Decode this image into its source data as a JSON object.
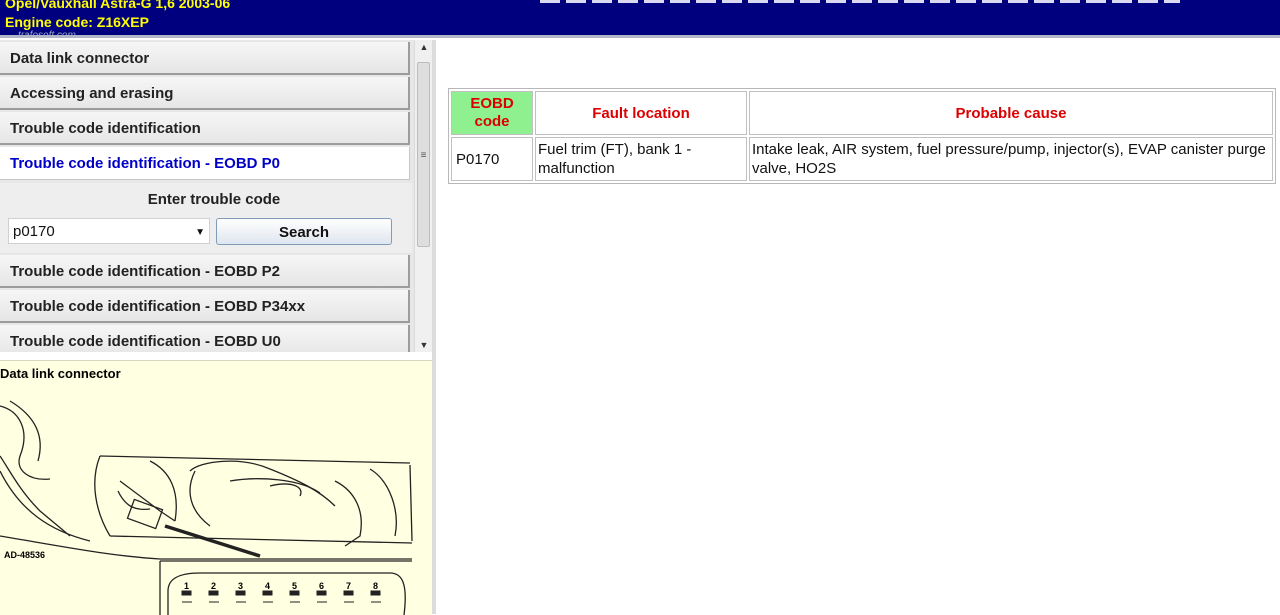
{
  "header": {
    "vehicle_line": "Opel/Vauxhall   Astra-G  1,6  2003-06",
    "engine_line": "Engine code: Z16XEP",
    "watermark": "trafosoft.com"
  },
  "nav": {
    "items": [
      {
        "label": "Data link connector"
      },
      {
        "label": "Accessing and erasing"
      },
      {
        "label": "Trouble code identification"
      },
      {
        "label": "Trouble code identification - EOBD P0"
      },
      {
        "label": "Trouble code identification - EOBD P2"
      },
      {
        "label": "Trouble code identification - EOBD P34xx"
      },
      {
        "label": "Trouble code identification - EOBD U0"
      }
    ],
    "active_index": 3
  },
  "search": {
    "label": "Enter trouble code",
    "value": "p0170",
    "button_label": "Search"
  },
  "diagram": {
    "title": "Data link connector",
    "ref_code": "AD-48536",
    "pins": [
      "1",
      "2",
      "3",
      "4",
      "5",
      "6",
      "7",
      "8"
    ]
  },
  "table": {
    "headers": {
      "code": "EOBD code",
      "fault": "Fault location",
      "cause": "Probable cause"
    },
    "rows": [
      {
        "code": "P0170",
        "fault": "Fuel trim (FT), bank 1 - malfunction",
        "cause": "Intake leak, AIR system, fuel pressure/pump, injector(s), EVAP canister purge valve, HO2S"
      }
    ]
  },
  "colors": {
    "header_bg": "#00007f",
    "header_text": "#ffff00",
    "active_link": "#0000c8",
    "table_head_text": "#dd0000",
    "code_head_bg": "#8ff08f",
    "diagram_bg": "#ffffe1"
  }
}
